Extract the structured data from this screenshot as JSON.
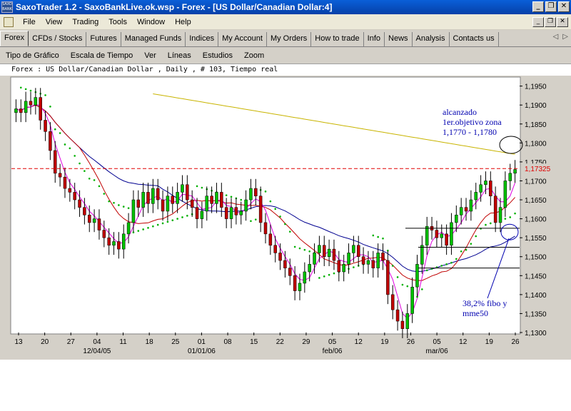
{
  "window": {
    "title": "SaxoTrader 1.2 - SaxoBankLive.ok.wsp - Forex - [US Dollar/Canadian Dollar:4]",
    "icon_text": "SAXO BANK",
    "minimize": "_",
    "restore": "❐",
    "close": "✕"
  },
  "menu": {
    "items": [
      "File",
      "View",
      "Trading",
      "Tools",
      "Window",
      "Help"
    ],
    "mdi": {
      "minimize": "_",
      "restore": "❐",
      "close": "✕"
    }
  },
  "tabs": {
    "items": [
      "Forex",
      "CFDs / Stocks",
      "Futures",
      "Managed Funds",
      "Indices",
      "My Account",
      "My Orders",
      "How to trade",
      "Info",
      "News",
      "Analysis",
      "Contacts us"
    ],
    "active": "Forex",
    "left_arrow": "◁",
    "right_arrow": "▷"
  },
  "toolbar": {
    "items": [
      "Tipo de Gráfico",
      "Escala de Tiempo",
      "Ver",
      "Líneas",
      "Estudios",
      "Zoom"
    ]
  },
  "chart_header": "Forex : US Dollar/Canadian Dollar , Daily , # 103, Tiempo real",
  "annotations": {
    "top": [
      "alcanzado",
      "1er.objetivo zona",
      "1,1770 - 1,1780"
    ],
    "bottom": [
      "38,2% fibo y",
      "mme50"
    ]
  },
  "colors": {
    "up_candle": "#00c000",
    "down_candle": "#c00000",
    "sma_long": "#c8b400",
    "ma_blue": "#000090",
    "ma_red": "#c00000",
    "ma_magenta": "#e000e0",
    "sar": "#00b000",
    "dashed_level": "#e00000",
    "annotation_text": "#0000b0"
  },
  "chart_data": {
    "type": "candlestick",
    "ylim": [
      1.13,
      1.197
    ],
    "y_ticks": [
      "1,1950",
      "1,1900",
      "1,1850",
      "1,1800",
      "1,1750",
      "1,1700",
      "1,1650",
      "1,1600",
      "1,1550",
      "1,1500",
      "1,1450",
      "1,1400",
      "1,1350",
      "1,1300"
    ],
    "y_tick_values": [
      1.195,
      1.19,
      1.185,
      1.18,
      1.175,
      1.17,
      1.165,
      1.16,
      1.155,
      1.15,
      1.145,
      1.14,
      1.135,
      1.13
    ],
    "x_ticks": [
      "13",
      "20",
      "27",
      "04",
      "11",
      "18",
      "25",
      "01",
      "08",
      "15",
      "22",
      "29",
      "05",
      "12",
      "19",
      "26",
      "05",
      "12",
      "19",
      "26"
    ],
    "x_month_labels": [
      "12/04/05",
      "01/01/06",
      "feb/06",
      "mar/06"
    ],
    "dashed_level": {
      "value": 1.17325,
      "label": "1,17325"
    },
    "horizontal_lines": [
      1.1575,
      1.1525,
      1.147
    ],
    "close": [
      1.189,
      1.188,
      1.191,
      1.19,
      1.192,
      1.186,
      1.183,
      1.178,
      1.172,
      1.171,
      1.168,
      1.167,
      1.165,
      1.163,
      1.161,
      1.159,
      1.16,
      1.157,
      1.155,
      1.153,
      1.154,
      1.152,
      1.156,
      1.159,
      1.165,
      1.163,
      1.167,
      1.164,
      1.168,
      1.165,
      1.162,
      1.166,
      1.164,
      1.167,
      1.169,
      1.165,
      1.163,
      1.16,
      1.162,
      1.166,
      1.164,
      1.167,
      1.163,
      1.16,
      1.163,
      1.161,
      1.162,
      1.165,
      1.168,
      1.166,
      1.159,
      1.156,
      1.153,
      1.151,
      1.149,
      1.147,
      1.145,
      1.141,
      1.143,
      1.146,
      1.148,
      1.151,
      1.153,
      1.15,
      1.152,
      1.149,
      1.146,
      1.148,
      1.151,
      1.153,
      1.15,
      1.148,
      1.149,
      1.147,
      1.151,
      1.149,
      1.14,
      1.136,
      1.133,
      1.131,
      1.135,
      1.142,
      1.148,
      1.153,
      1.158,
      1.157,
      1.155,
      1.156,
      1.153,
      1.159,
      1.161,
      1.163,
      1.162,
      1.165,
      1.167,
      1.169,
      1.17,
      1.166,
      1.159,
      1.163,
      1.17,
      1.172,
      1.173
    ]
  }
}
